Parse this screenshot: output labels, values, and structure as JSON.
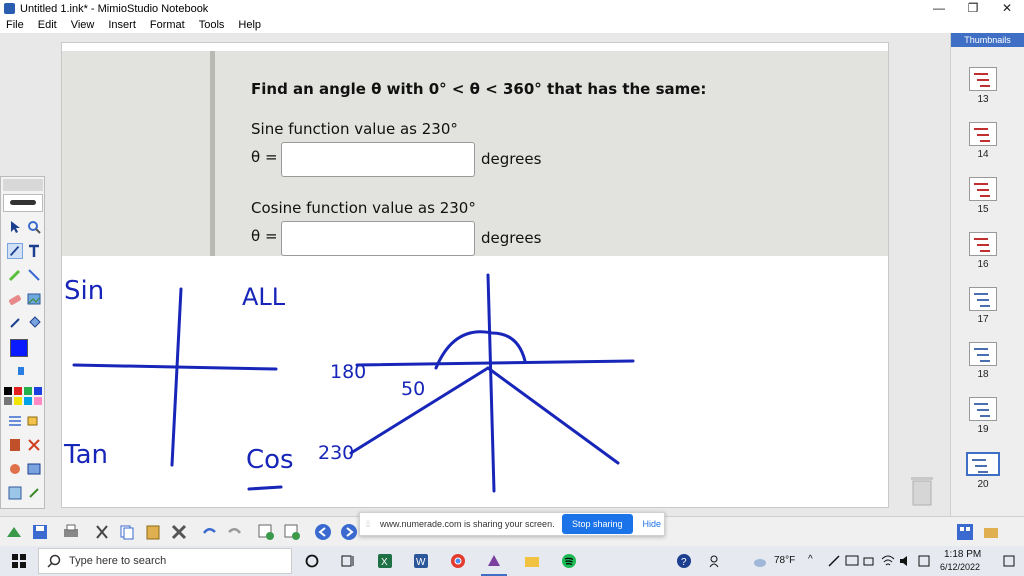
{
  "window": {
    "title": "Untitled 1.ink* - MimioStudio Notebook",
    "minimize": "—",
    "maximize": "❐",
    "close": "✕"
  },
  "menu": [
    "File",
    "Edit",
    "View",
    "Insert",
    "Format",
    "Tools",
    "Help"
  ],
  "problem": {
    "heading": "Find an angle θ with 0° < θ < 360° that has the same:",
    "sine_label": "Sine function value as 230°",
    "cosine_label": "Cosine function value as 230°",
    "theta_label": "θ =",
    "unit": "degrees"
  },
  "handwriting": {
    "sin": "Sin",
    "all": "ALL",
    "tan": "Tan",
    "cos": "Cos",
    "n180": "180",
    "n50": "50",
    "n230": "230"
  },
  "colors": {
    "ink": "#1726b8",
    "accent": "#3f6fc4",
    "share_button": "#1a73e8",
    "current_color": "#0a1cff"
  },
  "sidebar": {
    "header": "Thumbnails",
    "pages": [
      "13",
      "14",
      "15",
      "16",
      "17",
      "18",
      "19",
      "20"
    ],
    "selected": "20"
  },
  "share_bar": {
    "message": "www.numerade.com is sharing your screen.",
    "stop": "Stop sharing",
    "hide": "Hide"
  },
  "taskbar": {
    "search_placeholder": "Type here to search",
    "weather": "78°F",
    "time": "1:18 PM",
    "date": "6/12/2022"
  }
}
